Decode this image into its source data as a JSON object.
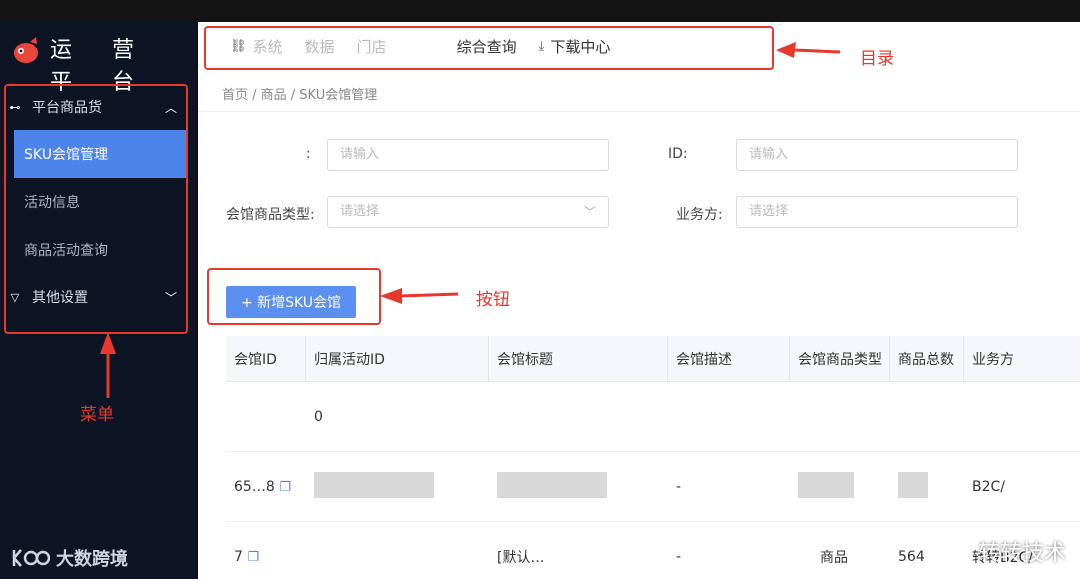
{
  "sidebar": {
    "logo_text": "运营平台",
    "groups": [
      {
        "label": "平台商品货",
        "expanded": true,
        "items": [
          {
            "label": "SKU会馆管理",
            "active": true
          },
          {
            "label": "活动信息"
          },
          {
            "label": "商品活动查询"
          }
        ]
      },
      {
        "label": "其他设置",
        "expanded": false
      }
    ],
    "footer_text": "大数跨境"
  },
  "nav": {
    "items": [
      {
        "label": "系统",
        "icon": "link-icon"
      },
      {
        "label": "数据"
      },
      {
        "label": "门店"
      },
      {
        "label": "综合查询"
      },
      {
        "label": "下载中心",
        "icon": "download-icon"
      }
    ]
  },
  "breadcrumb": "首页 / 商品 / SKU会馆管理",
  "filters": {
    "row1_label_a": ":",
    "row1_placeholder_a": "请输入",
    "row1_label_b": "ID:",
    "row1_placeholder_b": "请输入",
    "row2_label_a": "会馆商品类型:",
    "row2_placeholder_a": "请选择",
    "row2_label_b": "业务方:",
    "row2_placeholder_b": "请选择"
  },
  "add_button": "+ 新增SKU会馆",
  "table": {
    "headers": [
      "会馆ID",
      "归属活动ID",
      "会馆标题",
      "会馆描述",
      "会馆商品类型",
      "商品总数",
      "业务方"
    ],
    "rows": [
      {
        "id": "",
        "activity": "0",
        "title": "",
        "desc": "",
        "type": "",
        "total": "",
        "biz": ""
      },
      {
        "id": "65…8",
        "activity": "",
        "title": "",
        "desc": "-",
        "type": "",
        "total": "",
        "biz": "B2C/"
      },
      {
        "id": "7",
        "activity": "",
        "title": "[默认…",
        "desc": "-",
        "type": "商品",
        "total": "564",
        "biz": "转转B2C/"
      }
    ]
  },
  "annotations": {
    "nav_label": "目录",
    "button_label": "按钮",
    "menu_label": "菜单"
  },
  "watermark": "转转技术",
  "colors": {
    "sidebar_bg": "#0d1524",
    "active_menu": "#4d84e9",
    "primary_button": "#5b8ff0",
    "annotation_red": "#e8372c"
  }
}
